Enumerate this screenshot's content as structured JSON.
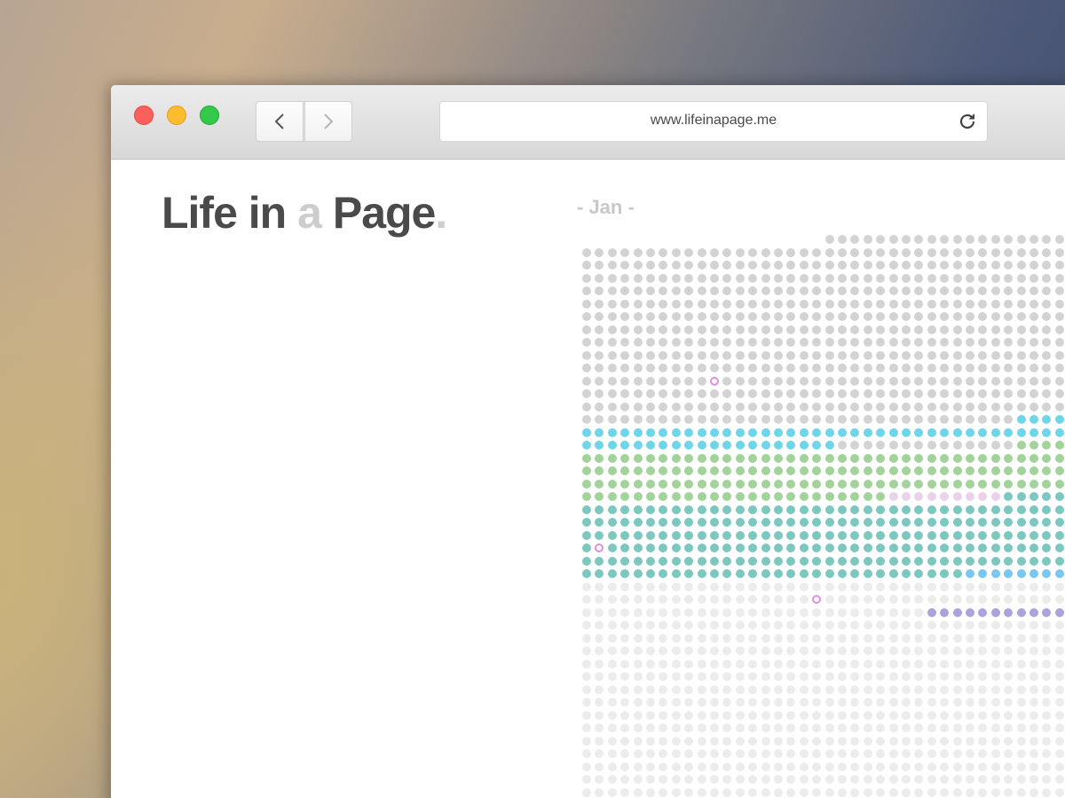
{
  "browser": {
    "url": "www.lifeinapage.me",
    "icons": {
      "back": "chevron-left-icon",
      "forward": "chevron-right-icon",
      "reload": "reload-icon"
    },
    "traffic_lights": {
      "close": "#fc605c",
      "minimize": "#fdbc2e",
      "zoom": "#34c94a"
    }
  },
  "page": {
    "logo": {
      "word1": "Life in",
      "word2": "a",
      "word3": "Page",
      "dot": "."
    },
    "month_label": "- Jan -"
  },
  "calendar": {
    "columns": 38,
    "colors": {
      "past": "#d3d3d3",
      "future": "#ececec",
      "cyan": "#6fd6ea",
      "green": "#a2d49a",
      "teal": "#7cc8c0",
      "pink": "#ead2ea",
      "blue": "#79c7f1",
      "purple": "#a9a4dc",
      "highlight": "#dd8fe0"
    }
  }
}
